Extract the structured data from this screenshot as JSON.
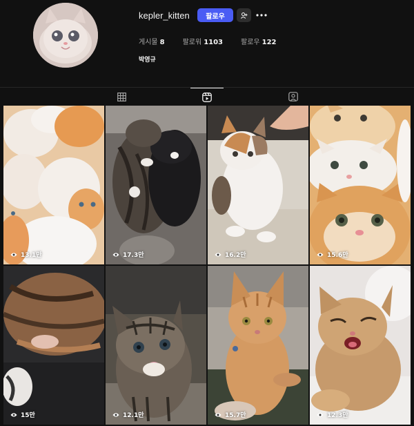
{
  "profile": {
    "username": "kepler_kitten",
    "follow_label": "팔로우",
    "posts_label": "게시물",
    "posts_count": "8",
    "followers_label": "팔로워",
    "followers_count": "1103",
    "following_label": "팔로우",
    "following_count": "122",
    "full_name": "박영규"
  },
  "tabs": [
    {
      "id": "posts",
      "icon": "grid-icon",
      "active": false
    },
    {
      "id": "reels",
      "icon": "reels-icon",
      "active": true
    },
    {
      "id": "tagged",
      "icon": "tagged-icon",
      "active": false
    }
  ],
  "reels": [
    {
      "views": "13.1만"
    },
    {
      "views": "17.3만"
    },
    {
      "views": "16.2만"
    },
    {
      "views": "15.6만"
    },
    {
      "views": "15만"
    },
    {
      "views": "12.1만"
    },
    {
      "views": "15.7만"
    },
    {
      "views": "12.3만"
    }
  ],
  "colors": {
    "background": "#111111",
    "accent": "#4a5cf4",
    "text": "#f5f5f5",
    "muted": "#a8a8a8"
  }
}
